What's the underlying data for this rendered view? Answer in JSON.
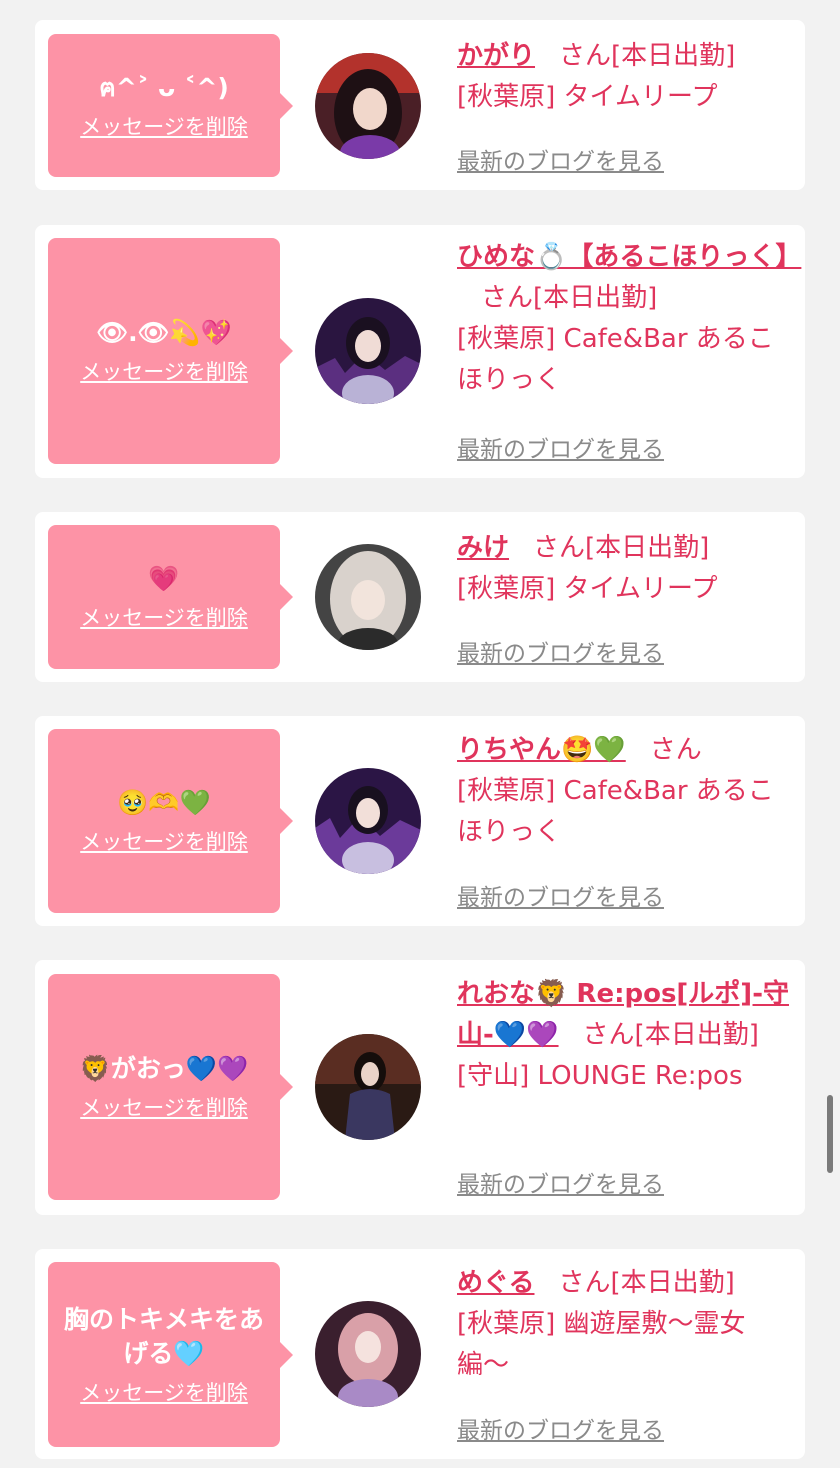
{
  "entries": [
    {
      "message": "ฅ^˃ ᴗ ˂^)",
      "delete_label": "メッセージを削除",
      "name": "かがり",
      "san": "さん[本日出勤]",
      "shop": "[秋葉原] タイムリープ",
      "blog_label": "最新のブログを見る"
    },
    {
      "message": "👁.👁💫💖",
      "delete_label": "メッセージを削除",
      "name": "ひめな💍【あるこほりっく】",
      "san": "さん[本日出勤]",
      "shop": "[秋葉原] Cafe&Bar あるこほりっく",
      "blog_label": "最新のブログを見る"
    },
    {
      "message": "💗",
      "delete_label": "メッセージを削除",
      "name": "みけ",
      "san": "さん[本日出勤]",
      "shop": "[秋葉原] タイムリープ",
      "blog_label": "最新のブログを見る"
    },
    {
      "message": "🥹🫶💚",
      "delete_label": "メッセージを削除",
      "name": "りちやん🤩💚",
      "san": "さん",
      "shop": "[秋葉原] Cafe&Bar あるこほりっく",
      "blog_label": "最新のブログを見る"
    },
    {
      "message": "🦁がおっ💙💜",
      "delete_label": "メッセージを削除",
      "name": "れおな🦁 Re:pos[ルポ]-守山-💙💜",
      "san": "さん[本日出勤]",
      "shop": "[守山] LOUNGE Re:pos",
      "blog_label": "最新のブログを見る"
    },
    {
      "message": "胸のトキメキをあげる🩵",
      "delete_label": "メッセージを削除",
      "name": "めぐる",
      "san": "さん[本日出勤]",
      "shop": "[秋葉原] 幽遊屋敷〜霊女編〜",
      "blog_label": "最新のブログを見る"
    }
  ],
  "avatars": [
    {
      "icon": "avatar-photo",
      "colors": [
        "#3b1a20",
        "#c0392b",
        "#f3d6c9"
      ]
    },
    {
      "icon": "avatar-photo",
      "colors": [
        "#2a1540",
        "#7b4fa8",
        "#e8e0f0"
      ]
    },
    {
      "icon": "avatar-photo",
      "colors": [
        "#3a3a3a",
        "#cfc6c0",
        "#f2ebe6"
      ]
    },
    {
      "icon": "avatar-photo",
      "colors": [
        "#2b1545",
        "#8a5cc0",
        "#efe6f5"
      ]
    },
    {
      "icon": "avatar-photo",
      "colors": [
        "#2a1a14",
        "#6b3a2a",
        "#e9d2c8"
      ]
    },
    {
      "icon": "avatar-photo",
      "colors": [
        "#3a1f2e",
        "#b48ac9",
        "#f3e0ea"
      ]
    }
  ],
  "colors": {
    "bubble": "#fd93a6",
    "accent": "#e0345c",
    "muted": "#8a8a8a",
    "background": "#f2f2f2"
  }
}
